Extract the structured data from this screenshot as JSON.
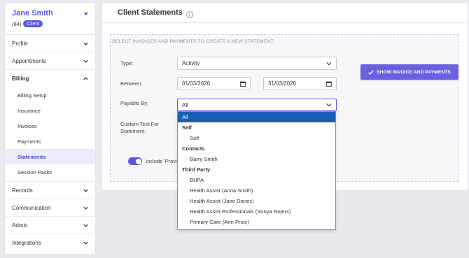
{
  "client": {
    "name": "Jane Smith",
    "id": "(84)",
    "badge": "Client"
  },
  "nav": {
    "profile": "Profile",
    "appointments": "Appointments",
    "billing": "Billing",
    "billing_items": [
      "Billing Setup",
      "Insurance",
      "Invoices",
      "Payments",
      "Statements",
      "Session Packs"
    ],
    "records": "Records",
    "communication": "Communication",
    "admin": "Admin",
    "integrations": "Integrations"
  },
  "page": {
    "title": "Client Statements",
    "section_heading": "SELECT INVOICES AND PAYMENTS TO CREATE A NEW STATEMENT"
  },
  "form": {
    "type_label": "Type:",
    "type_value": "Activity",
    "between_label": "Between:",
    "date_from": "01/03/2026",
    "date_to": "31/03/2026",
    "payable_label": "Payable By:",
    "payable_value": "All",
    "custom_text_label_1": "Custom Text For",
    "custom_text_label_2": "Statement:",
    "toggle_label": "Include 'Provide",
    "toggle_on": true,
    "button_label": "SHOW INVOICE AND PAYMENTS"
  },
  "dropdown": {
    "all": "All",
    "group_self": "Self",
    "opt_self": "Self",
    "group_contacts": "Contacts",
    "opt_barry": "Barry Smith",
    "group_third": "Third Party",
    "third_party": [
      "BUPA",
      "Health Assist (Anna Smith)",
      "Health Assist (Jane Danes)",
      "Health Assist Professionals (Sonya Rojers)",
      "Primary Care (Ann Price)"
    ]
  },
  "colors": {
    "accent": "#5b55e0",
    "button": "#6a5fe0",
    "highlight": "#1a5fb4"
  }
}
